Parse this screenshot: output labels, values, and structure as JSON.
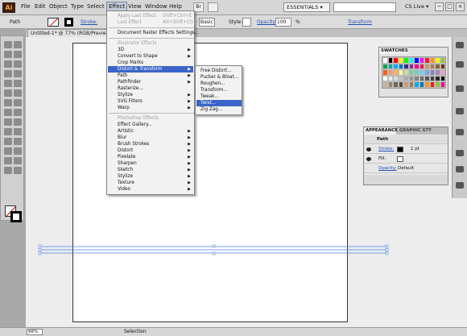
{
  "menubar": {
    "logo": "Ai",
    "items": [
      "File",
      "Edit",
      "Object",
      "Type",
      "Select",
      "Effect",
      "View",
      "Window",
      "Help"
    ],
    "workspace": "ESSENTIALS ▾",
    "cslive": "CS Live ▾",
    "window_buttons": [
      "−",
      "□",
      "×"
    ]
  },
  "control": {
    "selection": "Path",
    "stroke_label": "Stroke:",
    "brush": "Basic",
    "style_label": "Style:",
    "opacity_label": "Opacity:",
    "opacity_value": "100",
    "opacity_unit": "%",
    "transform": "Transform"
  },
  "document": {
    "tab_title": "Untitled-1* @ 77% (RGB/Preview)",
    "zoom": "66%",
    "status": "Selection"
  },
  "effect_menu": {
    "apply_last": "Apply Last Effect",
    "apply_last_shortcut": "Shift+Ctrl+E",
    "last_effect": "Last Effect",
    "last_effect_shortcut": "Alt+Shift+Ctrl+E",
    "doc_raster": "Document Raster Effects Settings...",
    "illustrator_header": "Illustrator Effects",
    "illustrator_items": [
      "3D",
      "Convert to Shape",
      "Crop Marks",
      "Distort & Transform",
      "Path",
      "Pathfinder",
      "Rasterize...",
      "Stylize",
      "SVG Filters",
      "Warp"
    ],
    "photoshop_header": "Photoshop Effects",
    "photoshop_items": [
      "Effect Gallery...",
      "Artistic",
      "Blur",
      "Brush Strokes",
      "Distort",
      "Pixelate",
      "Sharpen",
      "Sketch",
      "Stylize",
      "Texture",
      "Video"
    ]
  },
  "submenu": {
    "items": [
      "Free Distort...",
      "Pucker & Bloat...",
      "Roughen...",
      "Transform...",
      "Tweak...",
      "Twist...",
      "Zig Zag..."
    ]
  },
  "swatches": {
    "title": "SWATCHES",
    "colors": [
      "#ffffff",
      "#000000",
      "#ff0000",
      "#ffff00",
      "#00ff00",
      "#00ffff",
      "#0000ff",
      "#ff00ff",
      "#ed1c24",
      "#f7941d",
      "#fff200",
      "#8dc63f",
      "#00a651",
      "#00a99d",
      "#00aeef",
      "#0072bc",
      "#2e3192",
      "#92278f",
      "#ec008c",
      "#ed145b",
      "#c69c6d",
      "#a67c52",
      "#8c6239",
      "#603913",
      "#f26522",
      "#f7977a",
      "#fbaf5d",
      "#fff79a",
      "#c4df9b",
      "#82ca9c",
      "#7accc8",
      "#6dcff6",
      "#7da7d9",
      "#8781bd",
      "#a186be",
      "#f49ac1",
      "#ffffff",
      "#ebebeb",
      "#d7d7d7",
      "#c2c2c2",
      "#acacac",
      "#959595",
      "#808080",
      "#6b6b6b",
      "#555555",
      "#404040",
      "#2a2a2a",
      "#000000",
      "#c7b299",
      "#998675",
      "#736357",
      "#534741",
      "#c69c6d",
      "#a67c52",
      "#00aeef",
      "#0072bc",
      "#f7941d",
      "#ed1c24",
      "#8dc63f",
      "#ec008c"
    ]
  },
  "appearance": {
    "tab": "APPEARANCE",
    "graphic_tab": "GRAPHIC STY",
    "path_label": "Path",
    "stroke_label": "Stroke:",
    "stroke_value": "1 pt",
    "fill_label": "Fill:",
    "opacity_label": "Opacity:",
    "opacity_value": "Default"
  }
}
